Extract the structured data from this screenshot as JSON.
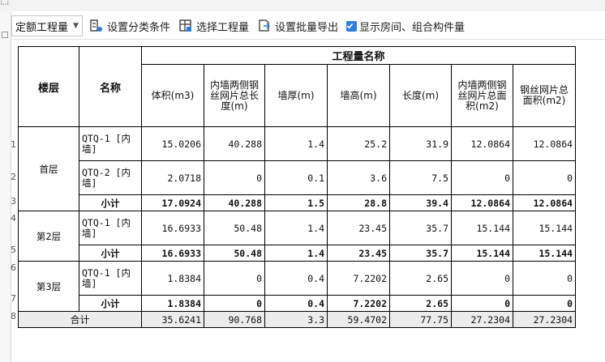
{
  "toolbar": {
    "quota_select": "定额工程量",
    "set_category": "设置分类条件",
    "select_quantity": "选择工程量",
    "set_batch_export": "设置批量导出",
    "show_rooms": "显示房间、组合构件量"
  },
  "table": {
    "header_floor": "楼层",
    "header_name": "名称",
    "header_group": "工程量名称",
    "columns": [
      "体积(m3)",
      "内墙两侧钢丝网片总长度(m)",
      "墙厚(m)",
      "墙高(m)",
      "长度(m)",
      "内墙两侧钢丝网片总面积(m2)",
      "钢丝网片总面积(m2)"
    ],
    "row_numbers": [
      "1",
      "2",
      "3",
      "4",
      "5",
      "6",
      "7",
      "8"
    ],
    "floors": [
      "首层",
      "第2层",
      "第3层"
    ],
    "subtotal_label": "小计",
    "total_label": "合计",
    "rows": [
      {
        "name": "QTQ-1 [内墙]",
        "values": [
          "15.0206",
          "40.288",
          "1.4",
          "25.2",
          "31.9",
          "12.0864",
          "12.0864"
        ]
      },
      {
        "name": "QTQ-2 [内墙]",
        "values": [
          "2.0718",
          "0",
          "0.1",
          "3.6",
          "7.5",
          "0",
          "0"
        ]
      },
      {
        "values": [
          "17.0924",
          "40.288",
          "1.5",
          "28.8",
          "39.4",
          "12.0864",
          "12.0864"
        ]
      },
      {
        "name": "QTQ-1 [内墙]",
        "values": [
          "16.6933",
          "50.48",
          "1.4",
          "23.45",
          "35.7",
          "15.144",
          "15.144"
        ]
      },
      {
        "values": [
          "16.6933",
          "50.48",
          "1.4",
          "23.45",
          "35.7",
          "15.144",
          "15.144"
        ]
      },
      {
        "name": "QTQ-1 [内墙]",
        "values": [
          "1.8384",
          "0",
          "0.4",
          "7.2202",
          "2.65",
          "0",
          "0"
        ]
      },
      {
        "values": [
          "1.8384",
          "0",
          "0.4",
          "7.2202",
          "2.65",
          "0",
          "0"
        ]
      },
      {
        "values": [
          "35.6241",
          "90.768",
          "3.3",
          "59.4702",
          "77.75",
          "27.2304",
          "27.2304"
        ]
      }
    ]
  }
}
